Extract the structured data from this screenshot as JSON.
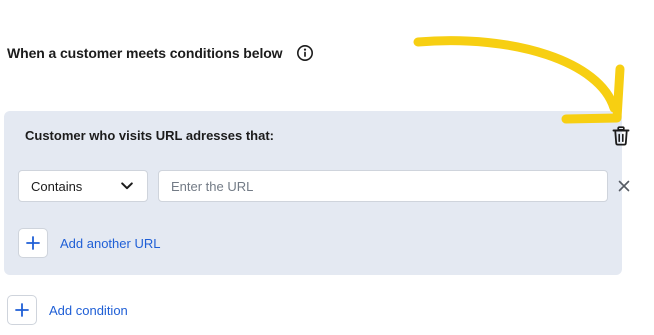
{
  "heading": {
    "title": "When a customer meets conditions below",
    "info_icon": "info-circle-icon"
  },
  "panel": {
    "title": "Customer who visits URL adresses that:",
    "delete_icon": "trash-icon",
    "rule": {
      "operator_selected": "Contains",
      "operator_icon": "chevron-down-icon",
      "url_value": "",
      "url_placeholder": "Enter the URL",
      "clear_icon": "close-icon"
    },
    "add_url_label": "Add another URL"
  },
  "add_condition_label": "Add condition",
  "colors": {
    "panel_background": "#e4e9f2",
    "link_blue": "#1f5fd6",
    "annotation_yellow": "#f7cf12",
    "text_dark": "#1c1c1c"
  }
}
